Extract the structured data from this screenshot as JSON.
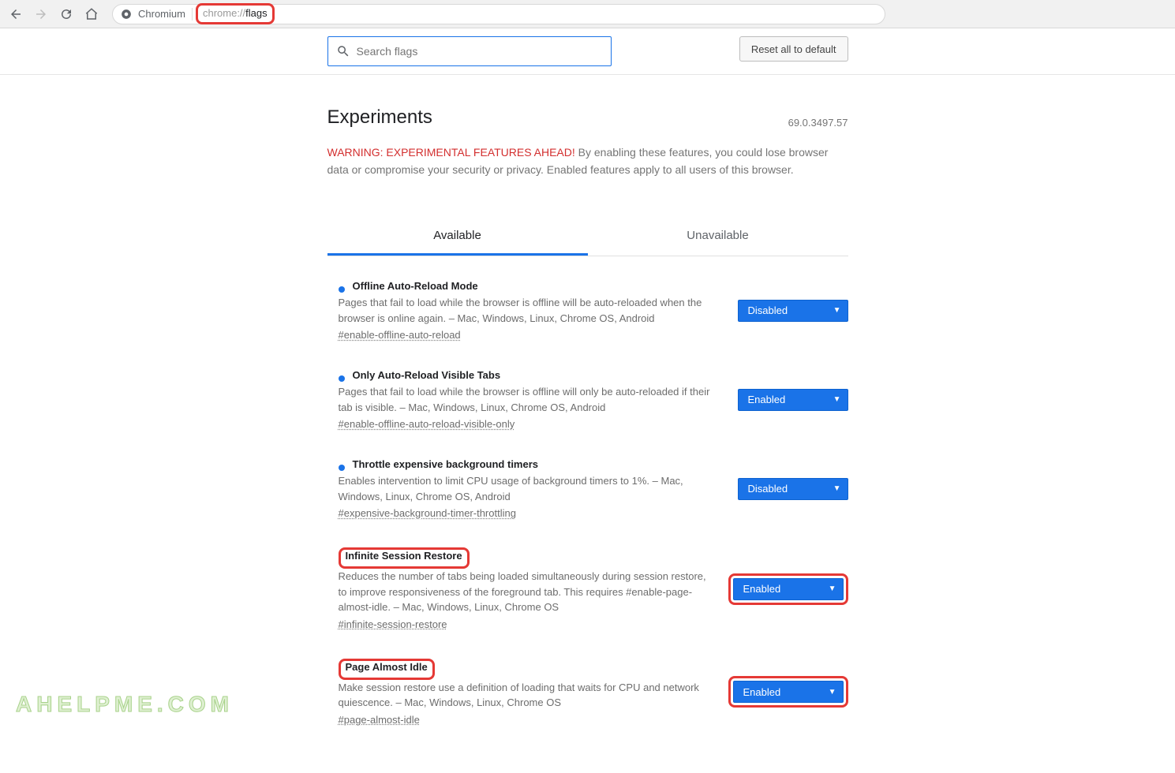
{
  "toolbar": {
    "chromium_label": "Chromium",
    "url_prefix": "chrome://",
    "url_bold": "flags"
  },
  "header": {
    "search_placeholder": "Search flags",
    "reset_label": "Reset all to default",
    "title": "Experiments",
    "version": "69.0.3497.57",
    "warning_label": "WARNING: EXPERIMENTAL FEATURES AHEAD!",
    "warning_text": " By enabling these features, you could lose browser data or compromise your security or privacy. Enabled features apply to all users of this browser."
  },
  "tabs": {
    "available": "Available",
    "unavailable": "Unavailable"
  },
  "flags": [
    {
      "title": "Offline Auto-Reload Mode",
      "desc": "Pages that fail to load while the browser is offline will be auto-reloaded when the browser is online again. – Mac, Windows, Linux, Chrome OS, Android",
      "hash": "#enable-offline-auto-reload",
      "state": "Disabled",
      "highlight_title": false,
      "highlight_select": false
    },
    {
      "title": "Only Auto-Reload Visible Tabs",
      "desc": "Pages that fail to load while the browser is offline will only be auto-reloaded if their tab is visible. – Mac, Windows, Linux, Chrome OS, Android",
      "hash": "#enable-offline-auto-reload-visible-only",
      "state": "Enabled",
      "highlight_title": false,
      "highlight_select": false
    },
    {
      "title": "Throttle expensive background timers",
      "desc": "Enables intervention to limit CPU usage of background timers to 1%. – Mac, Windows, Linux, Chrome OS, Android",
      "hash": "#expensive-background-timer-throttling",
      "state": "Disabled",
      "highlight_title": false,
      "highlight_select": false
    },
    {
      "title": "Infinite Session Restore",
      "desc": "Reduces the number of tabs being loaded simultaneously during session restore, to improve responsiveness of the foreground tab. This requires #enable-page-almost-idle. – Mac, Windows, Linux, Chrome OS",
      "hash": "#infinite-session-restore",
      "state": "Enabled",
      "highlight_title": true,
      "highlight_select": true
    },
    {
      "title": "Page Almost Idle",
      "desc": "Make session restore use a definition of loading that waits for CPU and network quiescence. – Mac, Windows, Linux, Chrome OS",
      "hash": "#page-almost-idle",
      "state": "Enabled",
      "highlight_title": true,
      "highlight_select": true
    }
  ],
  "watermark": "AHELPME.COM"
}
